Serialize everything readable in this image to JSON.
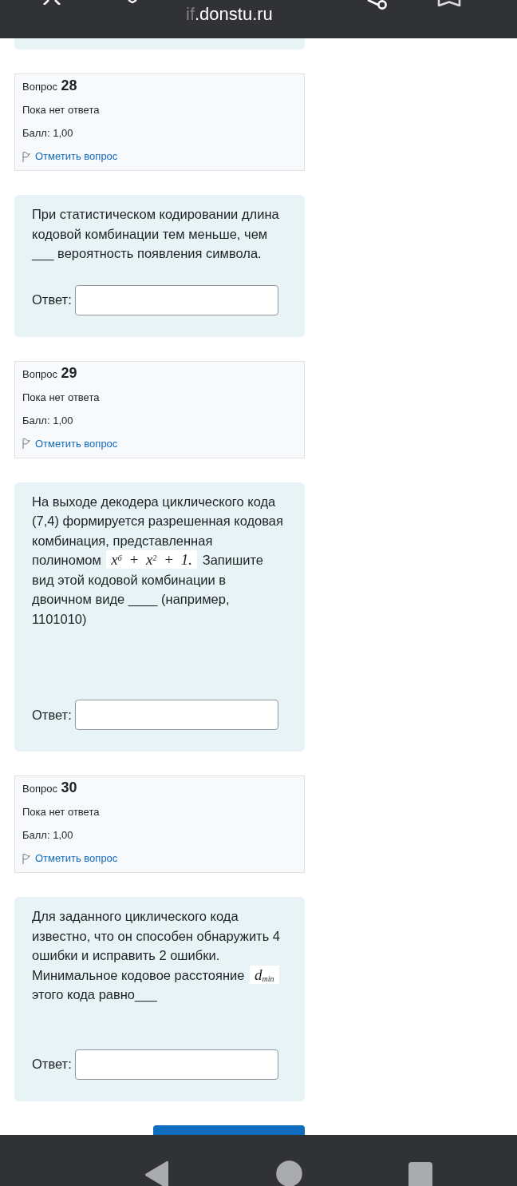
{
  "browser_bar": {
    "address_faded": "if",
    "address": ".donstu.ru"
  },
  "questions": [
    {
      "title": "Вопрос **28**",
      "status": "Пока нет ответа",
      "grade": "Балл: 1,00",
      "flag_link": "Отметить вопрос",
      "text": [
        {
          "kind": "text",
          "text": "При статистическом кодировании длина кодовой комбинации тем меньше, чем ___ вероятность появления символа."
        }
      ],
      "answer_label": "Ответ:"
    },
    {
      "title": "Вопрос **29**",
      "status": "Пока нет ответа",
      "grade": "Балл: 1,00",
      "flag_link": "Отметить вопрос",
      "text": [
        {
          "kind": "text",
          "text": "На выходе декодера циклического кода (7,4) формируется разрешенная кодовая комбинация, представленная полиномом "
        },
        {
          "kind": "formula",
          "text": "x$^{6}$ + x$^{2}$ + 1."
        },
        {
          "kind": "text",
          "text": " Запишите вид этой кодовой комбинации в двоичном виде ____ (например, 1101010)"
        }
      ],
      "answer_label": "Ответ:"
    },
    {
      "title": "Вопрос **30**",
      "status": "Пока нет ответа",
      "grade": "Балл: 1,00",
      "flag_link": "Отметить вопрос",
      "text": [
        {
          "kind": "text",
          "text": "Для заданного циклического кода известно, что он способен обнаружить 4 ошибки и исправить 2 ошибки. Минимальное кодовое расстояние "
        },
        {
          "kind": "formula",
          "text": "d$_{min}$"
        },
        {
          "kind": "text",
          "text": " этого кода равно___"
        }
      ],
      "answer_label": "Ответ:"
    }
  ]
}
